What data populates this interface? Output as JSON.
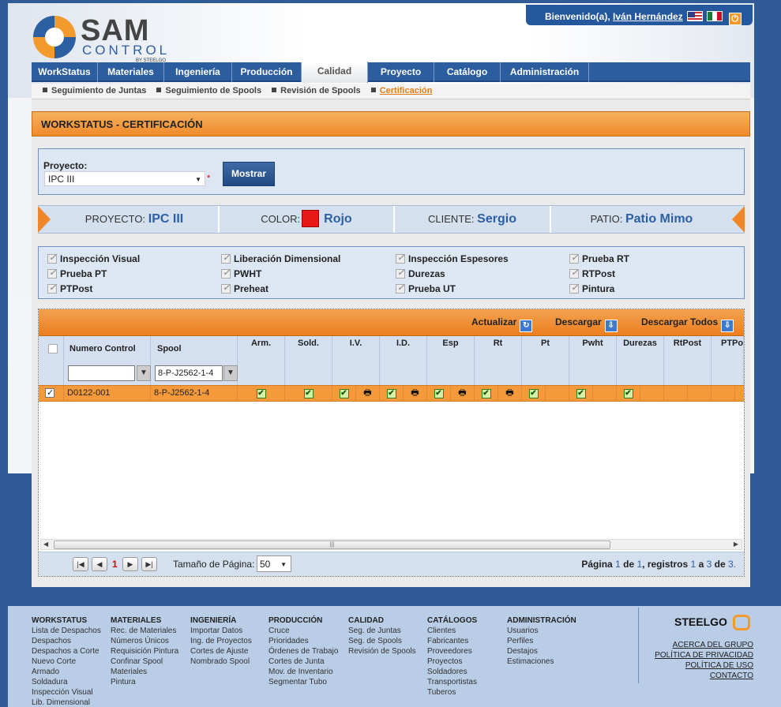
{
  "header": {
    "welcome_prefix": "Bienvenido(a),",
    "user_name": "Iván Hernández",
    "logo_main": "SAM",
    "logo_sub": "CONTROL",
    "logo_by": "BY STEELGO"
  },
  "nav": {
    "items": [
      "WorkStatus",
      "Materiales",
      "Ingeniería",
      "Producción",
      "Calidad",
      "Proyecto",
      "Catálogo",
      "Administración"
    ],
    "active": "Calidad"
  },
  "subnav": {
    "items": [
      "Seguimiento de Juntas",
      "Seguimiento de Spools",
      "Revisión de Spools",
      "Certificación"
    ],
    "current": "Certificación"
  },
  "title": "WORKSTATUS - CERTIFICACIÓN",
  "project_form": {
    "label": "Proyecto:",
    "selected": "IPC III",
    "required_mark": "*",
    "button": "Mostrar"
  },
  "info": {
    "proyecto_label": "PROYECTO:",
    "proyecto_value": "IPC III",
    "color_label": "COLOR:",
    "color_value": "Rojo",
    "color_hex": "#e81818",
    "cliente_label": "CLIENTE:",
    "cliente_value": "Sergio",
    "patio_label": "PATIO:",
    "patio_value": "Patio Mimo"
  },
  "checks": [
    [
      "Inspección Visual",
      "Liberación Dimensional",
      "Inspección Espesores",
      "Prueba RT"
    ],
    [
      "Prueba PT",
      "PWHT",
      "Durezas",
      "RTPost"
    ],
    [
      "PTPost",
      "Preheat",
      "Prueba UT",
      "Pintura"
    ]
  ],
  "grid": {
    "toolbar": {
      "refresh": "Actualizar",
      "download": "Descargar",
      "download_all": "Descargar Todos"
    },
    "col_numero": "Numero Control",
    "col_spool": "Spool",
    "filter_spool": "8-P-J2562-1-4",
    "filter_numero": "",
    "columns": [
      "Arm.",
      "Sold.",
      "I.V.",
      "I.D.",
      "Esp",
      "Rt",
      "Pt",
      "Pwht",
      "Durezas",
      "RtPost",
      "PTPos"
    ],
    "row": {
      "numero": "D0122-001",
      "spool": "8-P-J2562-1-4"
    }
  },
  "pager": {
    "current_page": "1",
    "page_size_label": "Tamaño de Página:",
    "page_size": "50",
    "summary_prefix": "Página",
    "summary_page": "1",
    "summary_of": "de",
    "summary_total_pages": "1",
    "summary_records": ", registros",
    "summary_from": "1",
    "summary_a": "a",
    "summary_to": "3",
    "summary_de": "de",
    "summary_total": "3."
  },
  "footer": {
    "columns": [
      {
        "title": "WORKSTATUS",
        "links": [
          "Lista de Despachos",
          "Despachos",
          "Despachos a Corte",
          "Nuevo Corte",
          "Armado",
          "Soldadura",
          "Inspección Visual",
          "Lib. Dimensional"
        ]
      },
      {
        "title": "MATERIALES",
        "links": [
          "Rec. de Materiales",
          "Números Únicos",
          "Requisición Pintura",
          "Confinar Spool",
          "Materiales",
          "Pintura"
        ]
      },
      {
        "title": "INGENIERÍA",
        "links": [
          "Importar Datos",
          "Ing. de Proyectos",
          "Cortes de Ajuste",
          "Nombrado Spool"
        ]
      },
      {
        "title": "PRODUCCIÓN",
        "links": [
          "Cruce",
          "Prioridades",
          "Órdenes de Trabajo",
          "Cortes de Junta",
          "Mov. de Inventario",
          "Segmentar Tubo"
        ]
      },
      {
        "title": "CALIDAD",
        "links": [
          "Seg. de Juntas",
          "Seg. de Spools",
          "Revisión de Spools"
        ]
      },
      {
        "title": "CATÁLOGOS",
        "links": [
          "Clientes",
          "Fabricantes",
          "Proveedores",
          "Proyectos",
          "Soldadores",
          "Transportistas",
          "Tuberos"
        ]
      },
      {
        "title": "ADMINISTRACIÓN",
        "links": [
          "Usuarios",
          "Perfiles",
          "Destajos",
          "Estimaciones"
        ]
      }
    ],
    "brand": "STEELGO",
    "links": [
      "ACERCA DEL GRUPO",
      "POLÍTICA DE PRIVACIDAD",
      "POLÍTICA DE USO",
      "CONTACTO"
    ]
  }
}
